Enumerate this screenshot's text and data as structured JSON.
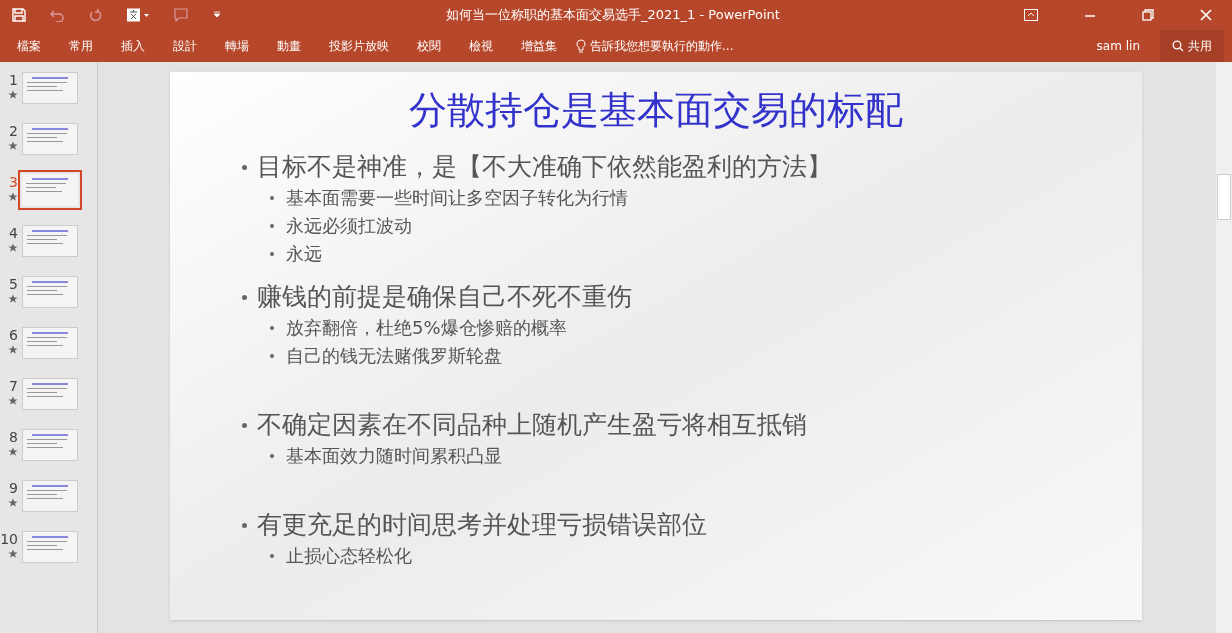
{
  "title_bar": {
    "title": "如何当一位称职的基本面交易选手_2021_1 - PowerPoint"
  },
  "ribbon": {
    "tabs": [
      {
        "label": "檔案",
        "selected": false
      },
      {
        "label": "常用",
        "selected": false
      },
      {
        "label": "插入",
        "selected": false
      },
      {
        "label": "設計",
        "selected": false
      },
      {
        "label": "轉場",
        "selected": false
      },
      {
        "label": "動畫",
        "selected": false
      },
      {
        "label": "投影片放映",
        "selected": false
      },
      {
        "label": "校閱",
        "selected": false
      },
      {
        "label": "檢視",
        "selected": false
      },
      {
        "label": "增益集",
        "selected": false
      }
    ],
    "tell_me": "告訴我您想要執行的動作...",
    "user": "sam lin",
    "share": "共用"
  },
  "thumbnails": [
    {
      "number": "1",
      "selected": false
    },
    {
      "number": "2",
      "selected": false
    },
    {
      "number": "3",
      "selected": true
    },
    {
      "number": "4",
      "selected": false
    },
    {
      "number": "5",
      "selected": false
    },
    {
      "number": "6",
      "selected": false
    },
    {
      "number": "7",
      "selected": false
    },
    {
      "number": "8",
      "selected": false
    },
    {
      "number": "9",
      "selected": false
    },
    {
      "number": "10",
      "selected": false
    }
  ],
  "slide": {
    "title": "分散持仓是基本面交易的标配",
    "bullets": [
      {
        "text": "目标不是神准，是【不大准确下依然能盈利的方法】",
        "children": [
          {
            "text": "基本面需要一些时间让多空因子转化为行情"
          },
          {
            "text": "永远必须扛波动"
          },
          {
            "text": "永远"
          }
        ]
      },
      {
        "text": "赚钱的前提是确保自己不死不重伤",
        "children": [
          {
            "text": "放弃翻倍，杜绝5%爆仓惨赔的概率"
          },
          {
            "text": "自己的钱无法赌俄罗斯轮盘"
          }
        ]
      },
      {
        "text": "不确定因素在不同品种上随机产生盈亏将相互抵销",
        "children": [
          {
            "text": "基本面效力随时间累积凸显"
          }
        ]
      },
      {
        "text": "有更充足的时间思考并处理亏损错误部位",
        "children": [
          {
            "text": "止损心态轻松化"
          }
        ]
      }
    ]
  }
}
